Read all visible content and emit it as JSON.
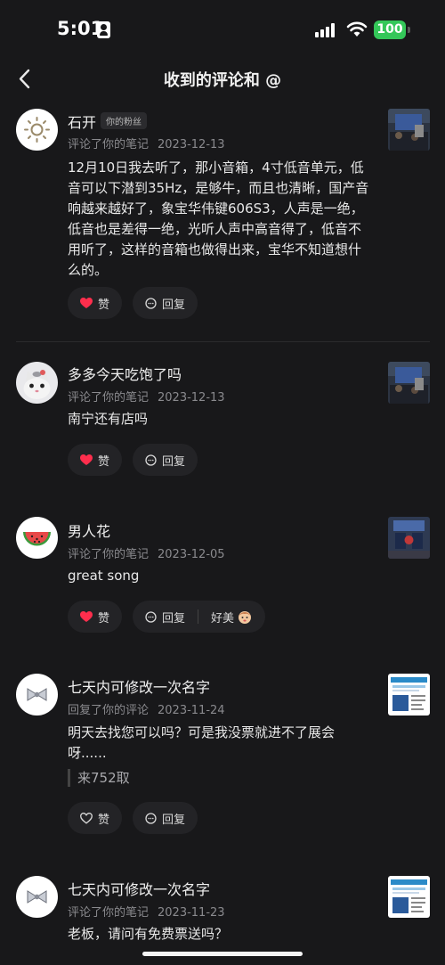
{
  "status_bar": {
    "time": "5:01",
    "battery": "100"
  },
  "nav": {
    "title": "收到的评论和 @"
  },
  "items": [
    {
      "name": "石开",
      "tag": "你的粉丝",
      "action": "评论了你的笔记",
      "date": "2023-12-13",
      "text": "12月10日我去听了，那小音箱，4寸低音单元，低音可以下潜到35Hz，是够牛，而且也清晰，国产音响越来越好了，象宝华伟键606S3，人声是一绝，低音也是差得一绝，光听人声中高音得了，低音不用听了，这样的音箱也做得出来，宝华不知道想什么的。",
      "like_label": "赞",
      "reply_label": "回复",
      "liked": true
    },
    {
      "name": "多多今天吃饱了吗",
      "action": "评论了你的笔记",
      "date": "2023-12-13",
      "text": "南宁还有店吗",
      "like_label": "赞",
      "reply_label": "回复",
      "liked": true
    },
    {
      "name": "男人花",
      "action": "评论了你的笔记",
      "date": "2023-12-05",
      "text": "great song",
      "like_label": "赞",
      "reply_label": "回复",
      "quick_reply": "好美",
      "liked": true
    },
    {
      "name": "七天内可修改一次名字",
      "action": "回复了你的评论",
      "date": "2023-11-24",
      "text": "明天去找您可以吗？可是我没票就进不了展会呀......",
      "quote": "来752取",
      "like_label": "赞",
      "reply_label": "回复",
      "liked": false
    },
    {
      "name": "七天内可修改一次名字",
      "action": "评论了你的笔记",
      "date": "2023-11-23",
      "text": "老板，请问有免费票送吗？"
    }
  ],
  "colors": {
    "like_red": "#ff2e4d",
    "battery_green": "#34c759",
    "background": "#18181a"
  },
  "icons": {
    "back": "chevron-left-icon",
    "like_filled": "heart-filled-icon",
    "like_outline": "heart-outline-icon",
    "reply": "comment-bubble-icon",
    "wifi": "wifi-icon",
    "signal": "cellular-signal-icon"
  }
}
